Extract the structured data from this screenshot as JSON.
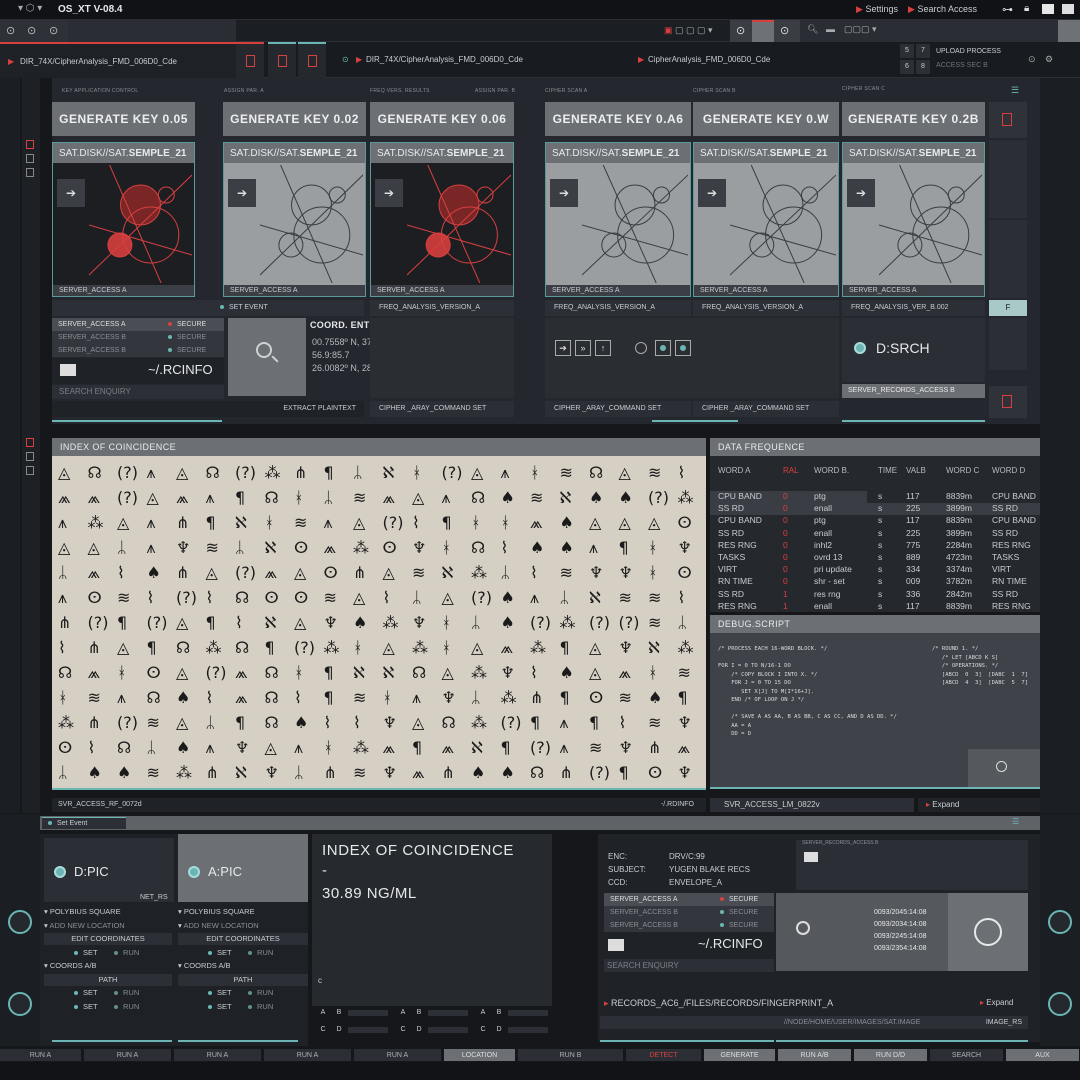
{
  "app": {
    "title": "OS_XT V-08.4",
    "settings": "Settings",
    "search_access": "Search Access"
  },
  "tabs": {
    "left_path": "DIR_74X/CipherAnalysis_FMD_006D0_Cde",
    "mid_path": "DIR_74X/CipherAnalysis_FMD_006D0_Cde",
    "right_path": "CipherAnalysis_FMD_006D0_Cde",
    "upload": "UPLOAD PROCESS",
    "access": "ACCESS SEC B",
    "n5": "5",
    "n7": "7",
    "n6": "6",
    "n8": "8"
  },
  "section_labels": {
    "a": "KEY APPLICATION CONTROL",
    "b": "ASSIGN PAR. A",
    "c": "FREQ VERS. RESULTS",
    "d": "ASSIGN PAR. B",
    "e": "CIPHER SCAN A",
    "f": "CIPHER SCAN B",
    "g": "CIPHER SCAN C"
  },
  "keys": [
    {
      "label": "GENERATE KEY 0.05",
      "title": "SAT.DISK//SAT.",
      "title_b": "SEMPLE_21",
      "foot": "SERVER_ACCESS A",
      "sub": "",
      "style": "red"
    },
    {
      "label": "GENERATE KEY 0.02",
      "title": "SAT.DISK//SAT.",
      "title_b": "SEMPLE_21",
      "foot": "SERVER_ACCESS A",
      "sub": "",
      "style": "gray"
    },
    {
      "label": "GENERATE KEY 0.06",
      "title": "SAT.DISK//SAT.",
      "title_b": "SEMPLE_21",
      "foot": "SERVER_ACCESS A",
      "sub": "FREQ_ANALYSIS_VERSION_A",
      "style": "red"
    },
    {
      "label": "GENERATE KEY 0.A6",
      "title": "SAT.DISK//SAT.",
      "title_b": "SEMPLE_21",
      "foot": "SERVER_ACCESS A",
      "sub": "FREQ_ANALYSIS_VERSION_A",
      "style": "gray"
    },
    {
      "label": "GENERATE KEY 0.W",
      "title": "SAT.DISK//SAT.",
      "title_b": "SEMPLE_21",
      "foot": "SERVER_ACCESS A",
      "sub": "FREQ_ANALYSIS_VERSION_A",
      "style": "gray"
    },
    {
      "label": "GENERATE KEY 0.2B",
      "title": "SAT.DISK//SAT.",
      "title_b": "SEMPLE_21",
      "foot": "SERVER_ACCESS A",
      "sub": "FREQ_ANALYSIS_VER_B.002",
      "style": "gray"
    }
  ],
  "set_event": "SET EVENT",
  "servers": [
    {
      "name": "SERVER_ACCESS A",
      "status": "SECURE",
      "red": true
    },
    {
      "name": "SERVER_ACCESS B",
      "status": "SECURE",
      "red": false
    },
    {
      "name": "SERVER_ACCESS B",
      "status": "SECURE",
      "red": false
    }
  ],
  "rcinfo": "~/.RCINFO",
  "search_enquiry": "SEARCH ENQUIRY",
  "extract": "EXTRACT PLAINTEXT",
  "coords": {
    "title": "COORD. ENTRIES",
    "lines": [
      "00.7558º N, 37.6173º E",
      "56.9:85.7",
      "26.0082º N, 28.9784º E"
    ]
  },
  "cmd1": "CIPHER _ARAY_COMMAND SET",
  "cmd2": "CIPHER _ARAY_COMMAND SET",
  "cmd3": "CIPHER _ARAY_COMMAND SET",
  "dsrch": "D:SRCH",
  "server_records_b": "SERVER_RECORDS_ACCESS B",
  "f_btn": "F",
  "ioc": {
    "title": "INDEX OF COINCIDENCE",
    "foot_left": "SVR_ACCESS_RF_0072d",
    "foot_right": "-/.RDINFO"
  },
  "freq": {
    "title": "DATA FREQUENCE",
    "headers": [
      "WORD A",
      "RAL",
      "WORD B.",
      "TIME",
      "VALB",
      "WORD C",
      "WORD D"
    ],
    "rows": [
      [
        "CPU BAND",
        "0",
        "ptg",
        "s",
        "117",
        "8839m",
        "CPU BAND"
      ],
      [
        "SS RD",
        "0",
        "enall",
        "s",
        "225",
        "3899m",
        "SS RD"
      ],
      [
        "CPU BAND",
        "0",
        "ptg",
        "s",
        "117",
        "8839m",
        "CPU BAND"
      ],
      [
        "SS RD",
        "0",
        "enall",
        "s",
        "225",
        "3899m",
        "SS RD"
      ],
      [
        "RES RNG",
        "0",
        "inhl2",
        "s",
        "775",
        "2284m",
        "RES RNG"
      ],
      [
        "TASKS",
        "0",
        "ovrd   13",
        "s",
        "889",
        "4723m",
        "TASKS"
      ],
      [
        "VIRT",
        "0",
        "pri update",
        "s",
        "334",
        "3374m",
        "VIRT"
      ],
      [
        "RN TIME",
        "0",
        "shr - set",
        "s",
        "009",
        "3782m",
        "RN TIME"
      ],
      [
        "SS RD",
        "1",
        "res rng",
        "s",
        "336",
        "2842m",
        "SS RD"
      ],
      [
        "RES RNG",
        "1",
        "enall",
        "s",
        "117",
        "8839m",
        "RES RNG"
      ]
    ]
  },
  "debug": {
    "title": "DEBUG.SCRIPT",
    "left": [
      "/* PROCESS EACH 16-WORD BLOCK. */",
      "",
      "FOR I = 0 TO N/16-1 DO",
      "    /* COPY BLOCK I INTO X. */",
      "    FOR J = 0 TO 15 DO",
      "       SET X[J] TO M[I*16+J].",
      "    END /* OF LOOP ON J */",
      "",
      "    /* SAVE A AS AA, B AS BB, C AS CC, AND D AS DD. */",
      "    AA = A",
      "    DD = D"
    ],
    "right": [
      "/* ROUND 1. */",
      "   /* LET [ABCD K S]",
      "   /* OPERATIONS. */",
      "   [ABCD  0  3]  [DABC  1  7]",
      "   [ABCD  4  3]  [DABC  5  7]"
    ],
    "foot": "SVR_ACCESS_LM_0822v",
    "expand": "Expand"
  },
  "bottom": {
    "set_event": "Set Event",
    "dpic": "D:PIC",
    "apic": "A:PIC",
    "net": "NET_RS",
    "left_items": [
      "POLYBIUS SQUARE",
      "ADD NEW LOCATION",
      "EDIT COORDINATES",
      "SET",
      "RUN",
      "COORDS A/B",
      "PATH",
      "SET",
      "RUN",
      "SET",
      "RUN"
    ],
    "right_items": [
      "POLYBIUS SQUARE",
      "ADD NEW LOCATION",
      "EDIT COORDINATES",
      "SET",
      "RUN",
      "COORDS A/B",
      "PATH",
      "SET",
      "RUN",
      "SET",
      "RUN"
    ],
    "ioc_title": "INDEX OF COINCIDENCE",
    "ioc_dash": "-",
    "ioc_value": "30.89 NG/ML",
    "c": "c",
    "grid": [
      "A",
      "B",
      "C",
      "D",
      "A",
      "B",
      "C",
      "D",
      "A",
      "B",
      "C",
      "D"
    ],
    "enc": {
      "enc_label": "ENC:",
      "enc": "DRV/C:99",
      "subj_label": "SUBJECT:",
      "subj": "YUGEN BLAKE RECS",
      "ccd_label": "CCD:",
      "ccd": "ENVELOPE_A"
    },
    "server_records_b": "SERVER_RECORDS_ACCESS B",
    "servers": [
      {
        "name": "SERVER_ACCESS A",
        "status": "SECURE",
        "red": true
      },
      {
        "name": "SERVER_ACCESS B",
        "status": "SECURE",
        "red": false
      },
      {
        "name": "SERVER_ACCESS B",
        "status": "SECURE",
        "red": false
      }
    ],
    "rcinfo": "~/.RCINFO",
    "search_enquiry": "SEARCH ENQUIRY",
    "times": [
      "0093/2045:14:08",
      "0093/2034:14:08",
      "0093/2245:14:08",
      "0093/2354:14:08"
    ],
    "records": "RECORDS_AC6_/FILES/RECORDS/FINGERPRINT_A",
    "expand": "Expand",
    "path": "//NODE/HOME/USER/IMAGES/SAT.IMAGE",
    "image_rs": "IMAGE_RS"
  },
  "footer": [
    "RUN A",
    "RUN A",
    "RUN A",
    "RUN A",
    "RUN A",
    "LOCATION",
    "RUN B",
    "DETECT",
    "GENERATE",
    "RUN A/B",
    "RUN D/D",
    "SEARCH",
    "AUX"
  ],
  "colors": {
    "accent": "#6bb6b4",
    "red": "#d84040",
    "panel": "#24272d"
  }
}
